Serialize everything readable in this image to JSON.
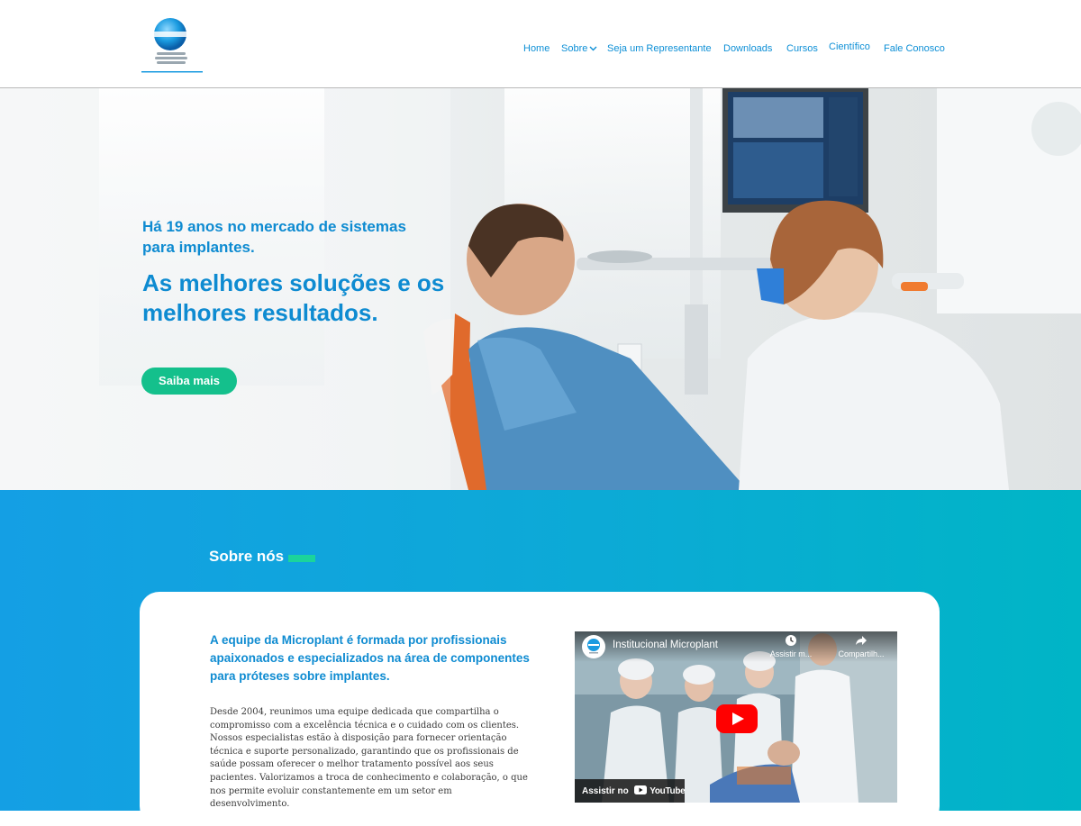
{
  "header": {
    "logo_text": "MICROPLANT",
    "nav": [
      {
        "label": "Home"
      },
      {
        "label": "Sobre",
        "has_dropdown": true
      },
      {
        "label": "Seja um Representante"
      },
      {
        "label": "Downloads"
      },
      {
        "label": "Cursos"
      },
      {
        "label": "Científico"
      },
      {
        "label": "Fale Conosco"
      }
    ]
  },
  "hero": {
    "subtitle": "Há 19 anos no mercado de sistemas para implantes.",
    "title": "As melhores soluções e os melhores resultados.",
    "cta_label": "Saiba mais"
  },
  "about": {
    "section_title": "Sobre nós",
    "heading": "A equipe da Microplant é formada por profissionais apaixonados e  especializados na área de componentes para próteses sobre implantes.",
    "body": "Desde 2004, reunimos uma equipe dedicada que compartilha o compromisso com a excelência técnica e o cuidado com os clientes. Nossos especialistas estão à disposição para fornecer orientação técnica e suporte personalizado, garantindo que os profissionais de saúde possam oferecer o melhor tratamento possível aos seus pacientes. Valorizamos a troca de conhecimento e colaboração, o que nos permite evoluir constantemente em um setor em desenvolvimento.",
    "video": {
      "title": "Institucional Microplant",
      "watch_later_label": "Assistir m...",
      "share_label": "Compartilh...",
      "watch_on_label": "Assistir no",
      "youtube_label": "YouTube"
    }
  },
  "colors": {
    "primary_blue": "#0e8bd1",
    "accent_green": "#14c08c",
    "section_gradient_start": "#149fe4",
    "section_gradient_end": "#00b5c6"
  }
}
